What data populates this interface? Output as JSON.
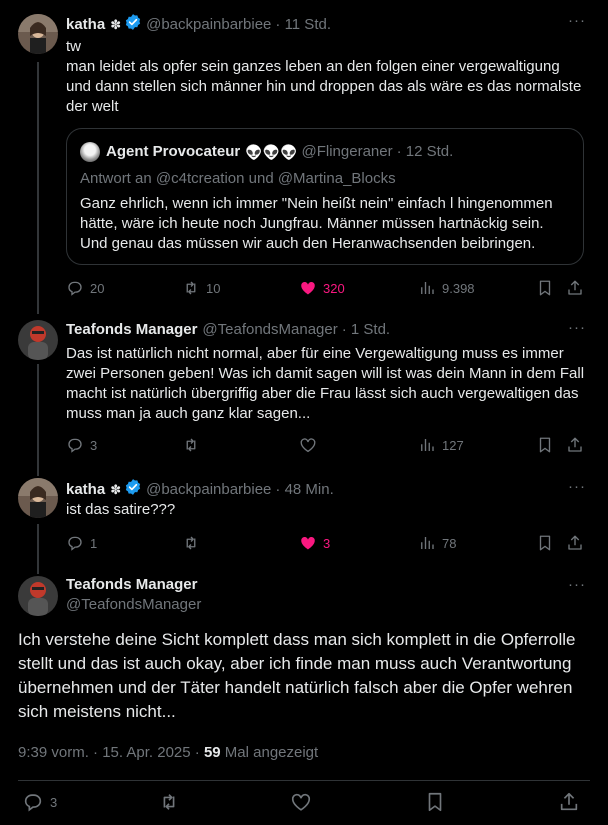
{
  "tweets": [
    {
      "name": "katha",
      "flower": "✽",
      "handle": "@backpainbarbiee",
      "time": "· 11 Std.",
      "text": "tw\nman leidet als opfer sein ganzes leben an den folgen einer vergewaltigung und dann stellen sich männer hin und droppen das als wäre es das normalste der welt",
      "quote": {
        "name": "Agent Provocateur",
        "emoji": "👽👽👽",
        "handle": "@Flingeraner",
        "time": "· 12 Std.",
        "reply": "Antwort an @c4tcreation und @Martina_Blocks",
        "text": "Ganz ehrlich, wenn ich immer \"Nein heißt nein\" einfach l hingenommen hätte, wäre ich heute noch Jungfrau. Männer müssen hartnäckig sein. Und genau das müssen wir auch den Heranwachsenden beibringen."
      },
      "replies": "20",
      "reposts": "10",
      "likes": "320",
      "views": "9.398"
    },
    {
      "name": "Teafonds Manager",
      "handle": "@TeafondsManager",
      "time": "· 1 Std.",
      "text": "Das ist natürlich nicht normal, aber für eine Vergewaltigung muss es immer zwei Personen geben! Was ich damit sagen will ist was dein Mann in dem Fall macht ist natürlich übergriffig aber die Frau lässt sich auch vergewaltigen das muss man ja auch ganz klar sagen...",
      "replies": "3",
      "reposts": "",
      "likes": "",
      "views": "127"
    },
    {
      "name": "katha",
      "flower": "✽",
      "handle": "@backpainbarbiee",
      "time": "· 48 Min.",
      "text": "ist das satire???",
      "replies": "1",
      "reposts": "",
      "likes": "3",
      "views": "78"
    }
  ],
  "main": {
    "name": "Teafonds Manager",
    "handle": "@TeafondsManager",
    "text": "Ich verstehe deine Sicht komplett dass man sich komplett in die Opferrolle stellt und das ist auch okay, aber ich finde man muss auch Verantwortung übernehmen und der Täter handelt natürlich falsch aber die Opfer wehren sich meistens nicht...",
    "timestamp": "9:39 vorm. · 15. Apr. 2025 · ",
    "views_count": "59",
    "views_label": " Mal angezeigt",
    "replies": "3"
  },
  "more_label": "···",
  "colors": {
    "accent_like": "#f91880",
    "verified": "#1d9bf0",
    "muted": "#71767b"
  }
}
